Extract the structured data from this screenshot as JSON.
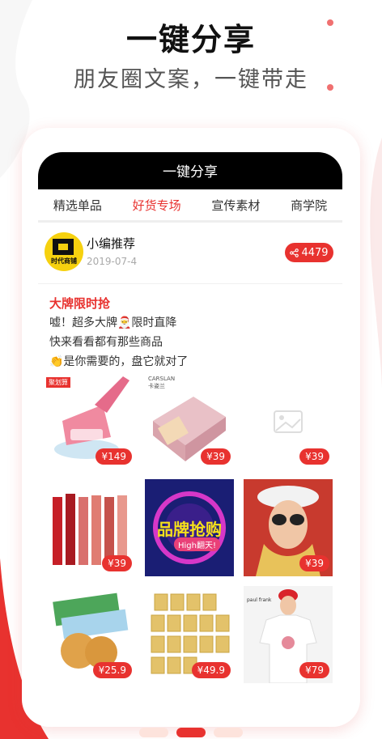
{
  "headline": {
    "title": "一键分享",
    "subtitle": "朋友圈文案，一键带走"
  },
  "app": {
    "title": "一键分享"
  },
  "tabs": [
    {
      "label": "精选单品",
      "active": false
    },
    {
      "label": "好货专场",
      "active": true
    },
    {
      "label": "宣传素材",
      "active": false
    },
    {
      "label": "商学院",
      "active": false
    }
  ],
  "post": {
    "avatar_text": "时代商铺",
    "poster": "小编推荐",
    "date": "2019-07-4",
    "share_count": "4479",
    "title": "大牌限时抢",
    "lines": [
      "嘘！超多大牌🎅限时直降",
      "快来看看都有那些商品",
      "👏是你需要的，盘它就对了"
    ]
  },
  "products": [
    {
      "name": "mite-remover",
      "price": "¥149",
      "badge": "聚划算",
      "brand": ""
    },
    {
      "name": "compact-powder",
      "price": "¥39",
      "badge": "",
      "brand": "CARSLAN 卡姿兰"
    },
    {
      "name": "image-placeholder",
      "price": "¥39",
      "badge": "",
      "brand": ""
    },
    {
      "name": "lipsticks",
      "price": "¥39",
      "badge": "",
      "brand": ""
    },
    {
      "name": "brand-sale-banner",
      "price": "",
      "badge": "",
      "brand": "品牌抢购",
      "tag": "High翻天!"
    },
    {
      "name": "sunglasses-model",
      "price": "¥39",
      "badge": "",
      "brand": ""
    },
    {
      "name": "biscuits",
      "price": "¥25.9",
      "badge": "",
      "brand": ""
    },
    {
      "name": "canned-drinks",
      "price": "¥49.9",
      "badge": "",
      "brand": ""
    },
    {
      "name": "tshirt-model",
      "price": "¥79",
      "badge": "",
      "brand": "paul frank"
    }
  ],
  "colors": {
    "accent": "#e8322f",
    "pager_active": "#e8322f",
    "pager_inactive": "#fde3dc"
  },
  "pager": {
    "count": 3,
    "active_index": 1
  }
}
